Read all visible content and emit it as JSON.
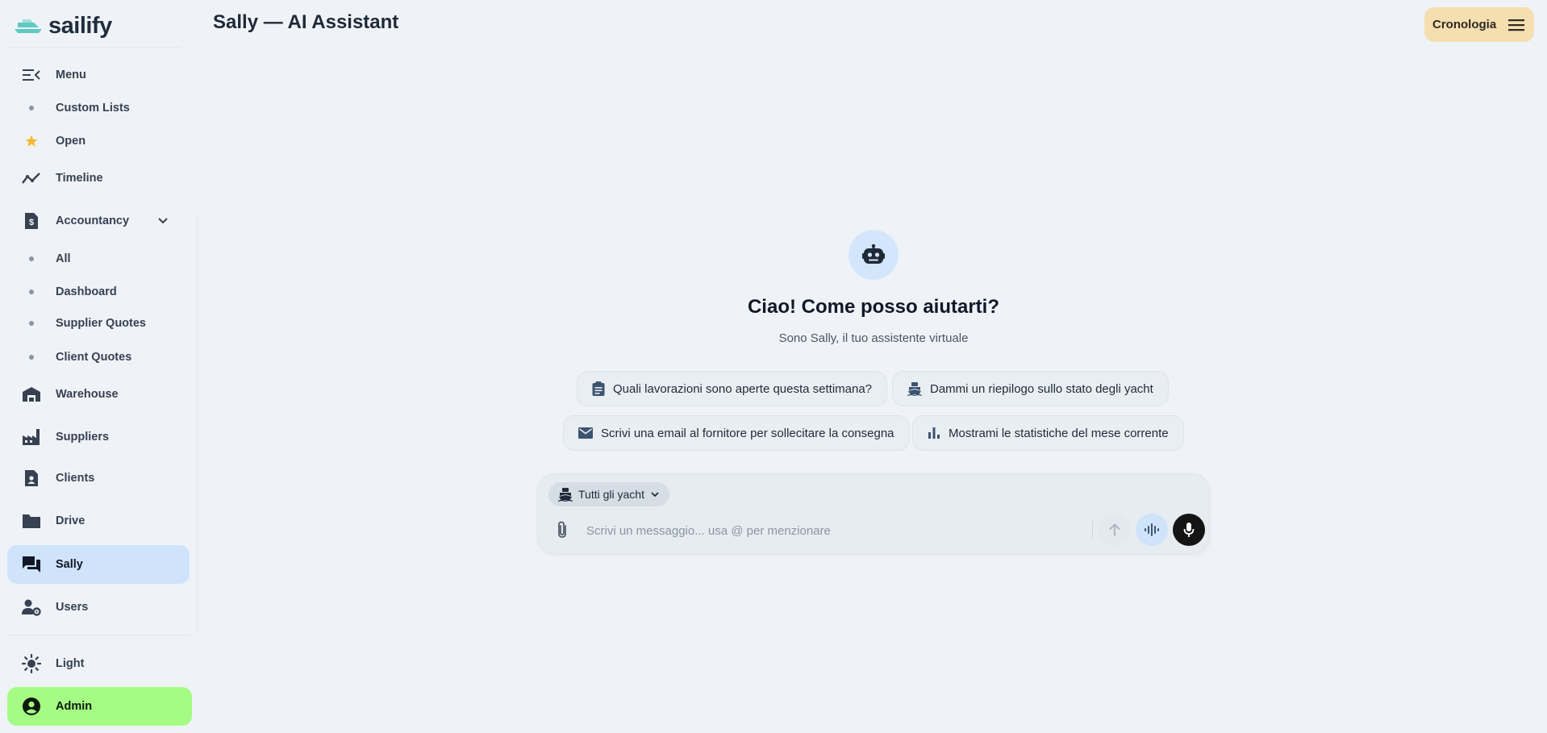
{
  "brand": {
    "name": "sailify"
  },
  "header": {
    "title": "Sally — AI Assistant",
    "history_label": "Cronologia"
  },
  "sidebar": {
    "items": [
      {
        "label": "Menu",
        "icon": "menu-collapse-icon"
      },
      {
        "label": "Custom Lists",
        "icon": "dot"
      },
      {
        "label": "Open",
        "icon": "star-icon"
      },
      {
        "label": "Timeline",
        "icon": "timeline-icon"
      },
      {
        "label": "Accountancy",
        "icon": "invoice-icon"
      },
      {
        "label": "All",
        "icon": "dot"
      },
      {
        "label": "Dashboard",
        "icon": "dot"
      },
      {
        "label": "Supplier Quotes",
        "icon": "dot"
      },
      {
        "label": "Client Quotes",
        "icon": "dot"
      },
      {
        "label": "Warehouse",
        "icon": "warehouse-icon"
      },
      {
        "label": "Suppliers",
        "icon": "factory-icon"
      },
      {
        "label": "Clients",
        "icon": "contact-file-icon"
      },
      {
        "label": "Drive",
        "icon": "folder-icon"
      },
      {
        "label": "Sally",
        "icon": "chat-icon"
      },
      {
        "label": "Users",
        "icon": "user-settings-icon"
      }
    ],
    "theme_label": "Light",
    "account_label": "Admin",
    "active": "Sally"
  },
  "welcome": {
    "title": "Ciao! Come posso aiutarti?",
    "subtitle": "Sono Sally, il tuo assistente virtuale"
  },
  "suggestions": [
    {
      "label": "Quali lavorazioni sono aperte questa settimana?",
      "icon": "clipboard-icon"
    },
    {
      "label": "Dammi un riepilogo sullo stato degli yacht",
      "icon": "ship-icon"
    },
    {
      "label": "Scrivi una email al fornitore per sollecitare la consegna",
      "icon": "mail-icon"
    },
    {
      "label": "Mostrami le statistiche del mese corrente",
      "icon": "bar-chart-icon"
    }
  ],
  "composer": {
    "yacht_filter": "Tutti gli yacht",
    "placeholder": "Scrivi un messaggio... usa @ per menzionare"
  },
  "colors": {
    "background": "#eff3f8",
    "active_nav": "#cfe3fb",
    "admin": "#a5fc84",
    "history_button": "#f5deb0",
    "brand_accent": "#5fc9c4"
  }
}
